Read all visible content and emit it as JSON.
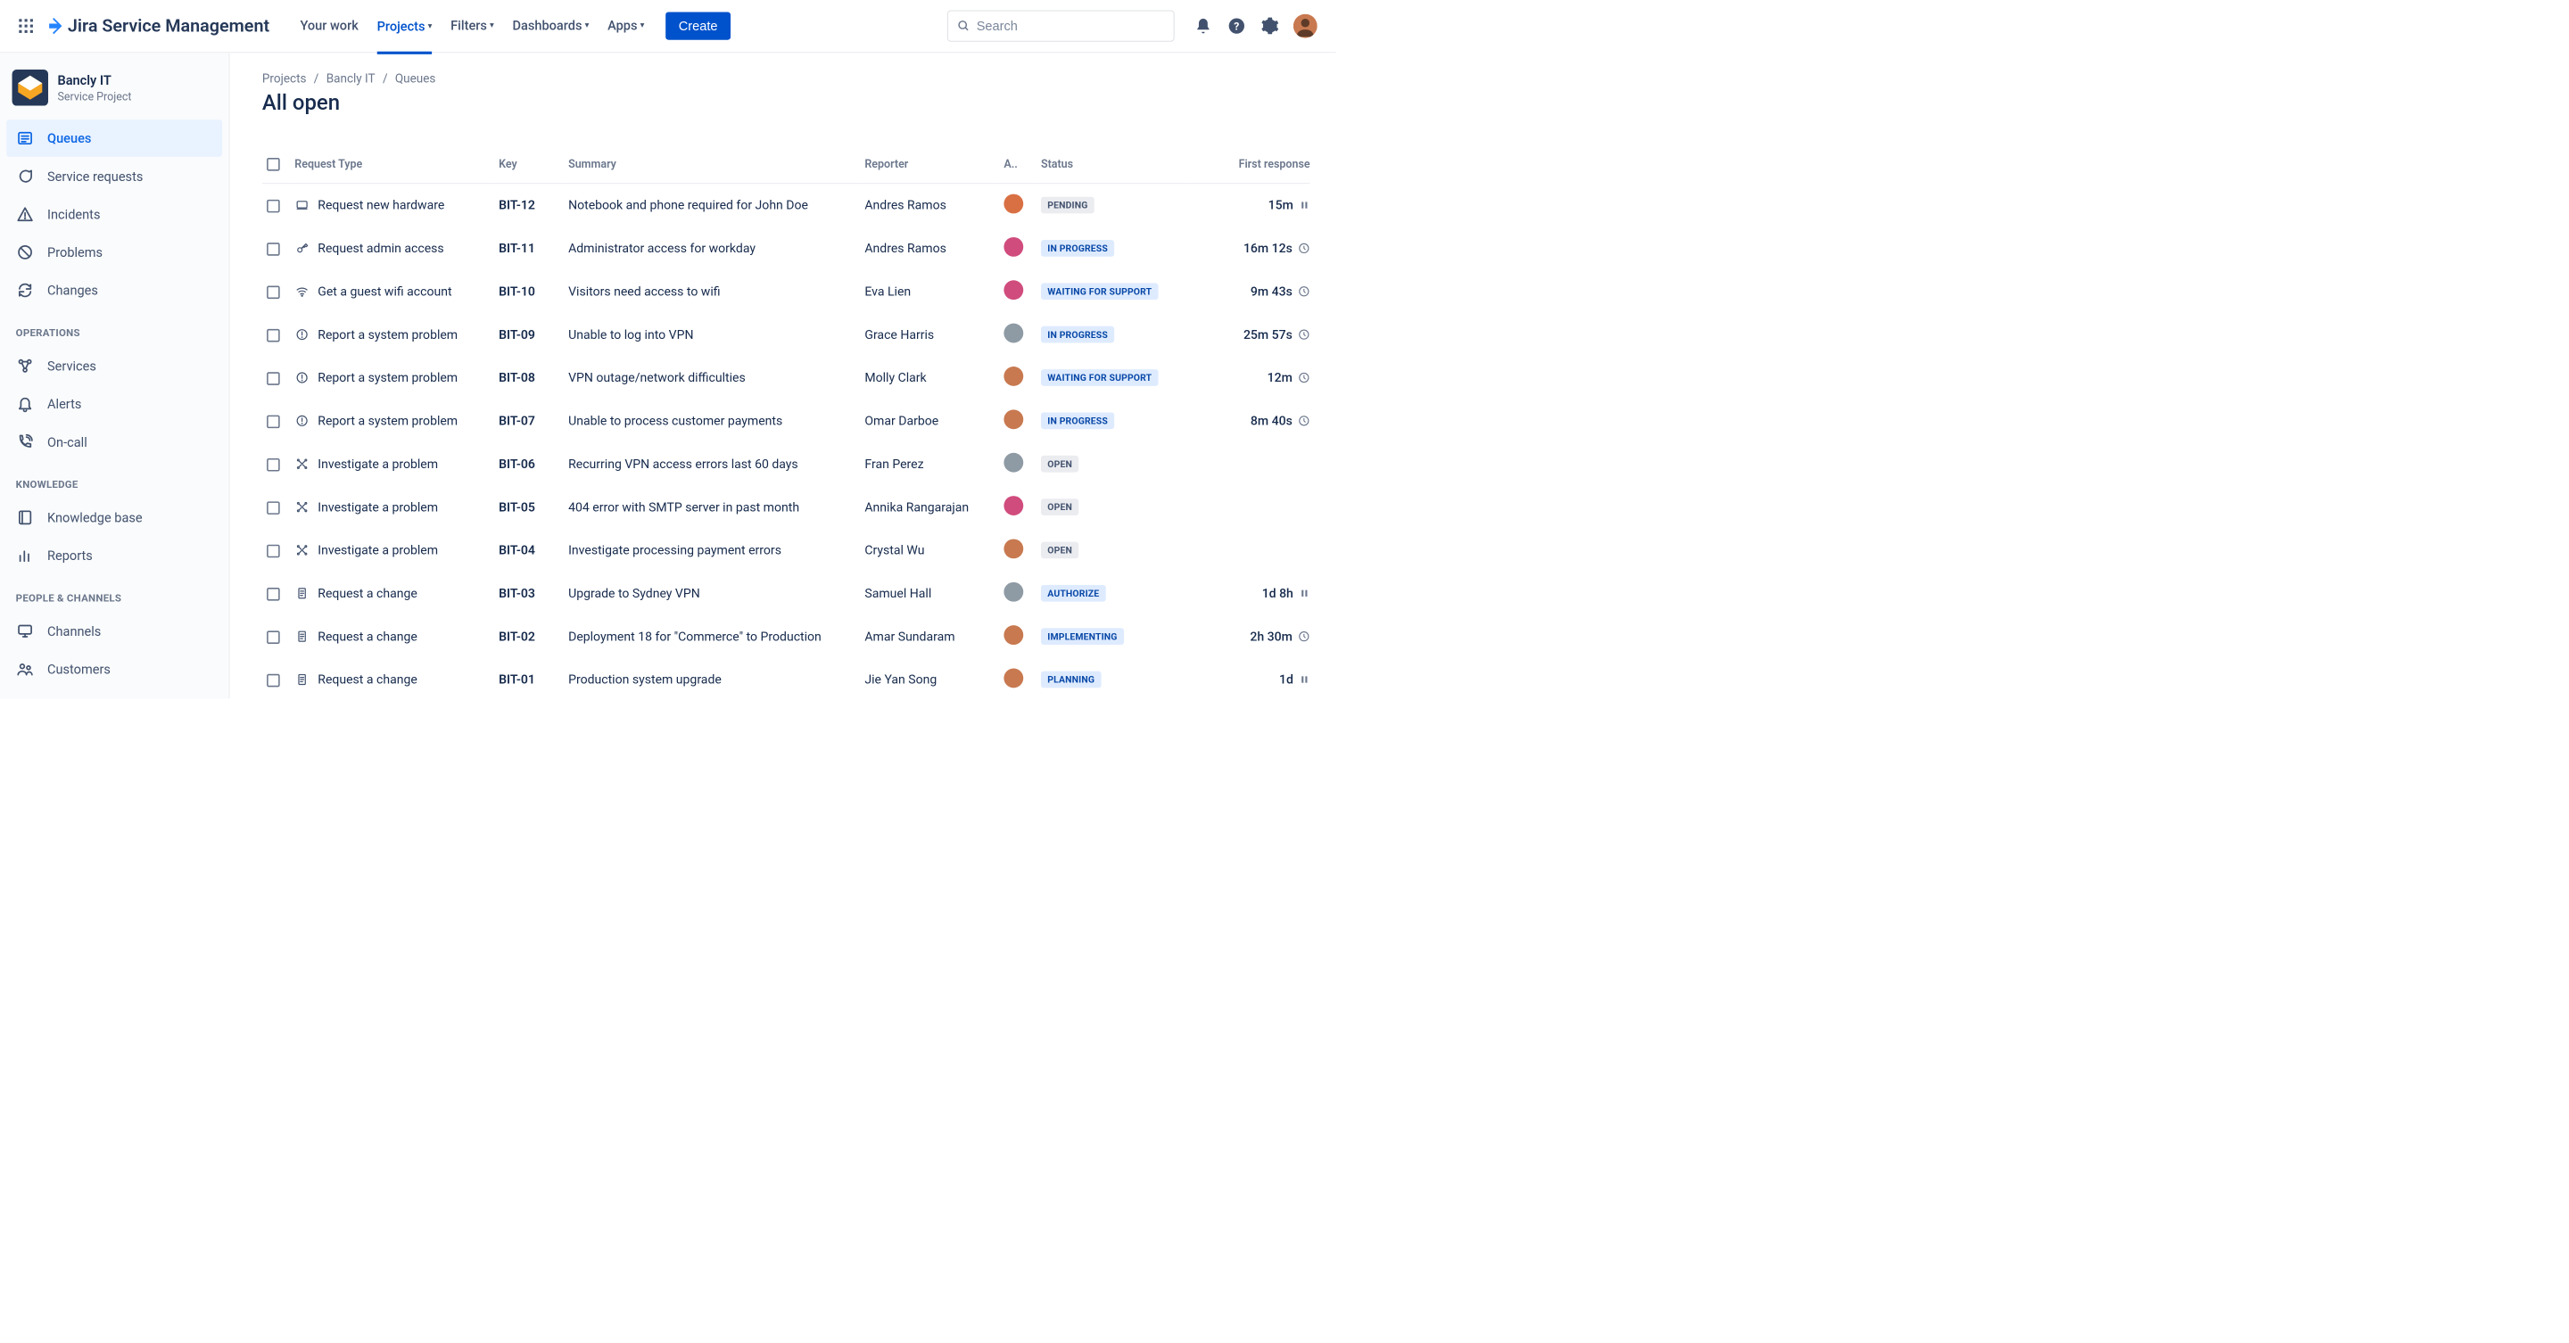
{
  "topnav": {
    "product_name": "Jira Service Management",
    "items": [
      {
        "label": "Your work",
        "has_chevron": false,
        "active": false
      },
      {
        "label": "Projects",
        "has_chevron": true,
        "active": true
      },
      {
        "label": "Filters",
        "has_chevron": true,
        "active": false
      },
      {
        "label": "Dashboards",
        "has_chevron": true,
        "active": false
      },
      {
        "label": "Apps",
        "has_chevron": true,
        "active": false
      }
    ],
    "create_label": "Create",
    "search_placeholder": "Search"
  },
  "sidebar": {
    "project": {
      "name": "Bancly IT",
      "subtitle": "Service Project"
    },
    "primary": [
      {
        "icon": "queues",
        "label": "Queues",
        "selected": true
      },
      {
        "icon": "chat",
        "label": "Service requests",
        "selected": false
      },
      {
        "icon": "incident",
        "label": "Incidents",
        "selected": false
      },
      {
        "icon": "problem",
        "label": "Problems",
        "selected": false
      },
      {
        "icon": "change",
        "label": "Changes",
        "selected": false
      }
    ],
    "operations_label": "OPERATIONS",
    "operations": [
      {
        "icon": "services",
        "label": "Services"
      },
      {
        "icon": "bell",
        "label": "Alerts"
      },
      {
        "icon": "oncall",
        "label": "On-call"
      }
    ],
    "knowledge_label": "KNOWLEDGE",
    "knowledge": [
      {
        "icon": "book",
        "label": "Knowledge base"
      },
      {
        "icon": "report",
        "label": "Reports"
      }
    ],
    "people_label": "PEOPLE & CHANNELS",
    "people": [
      {
        "icon": "monitor",
        "label": "Channels"
      },
      {
        "icon": "customers",
        "label": "Customers"
      }
    ]
  },
  "breadcrumbs": [
    "Projects",
    "Bancly IT",
    "Queues"
  ],
  "page_title": "All open",
  "columns": {
    "request_type": "Request Type",
    "key": "Key",
    "summary": "Summary",
    "reporter": "Reporter",
    "assignee": "A..",
    "status": "Status",
    "first_response": "First response"
  },
  "rows": [
    {
      "rt_icon": "hardware",
      "request_type": "Request new hardware",
      "key": "BIT-12",
      "summary": "Notebook and phone required for John Doe",
      "reporter": "Andres Ramos",
      "avatar": "#D97043",
      "status": "PENDING",
      "status_class": "pending",
      "resp": "15m",
      "resp_icon": "pause"
    },
    {
      "rt_icon": "admin",
      "request_type": "Request admin access",
      "key": "BIT-11",
      "summary": "Administrator access for workday",
      "reporter": "Andres Ramos",
      "avatar": "#D04C7D",
      "status": "IN PROGRESS",
      "status_class": "inprogress",
      "resp": "16m 12s",
      "resp_icon": "clock"
    },
    {
      "rt_icon": "wifi",
      "request_type": "Get a guest wifi account",
      "key": "BIT-10",
      "summary": "Visitors need access to wifi",
      "reporter": "Eva Lien",
      "avatar": "#D04C7D",
      "status": "WAITING FOR SUPPORT",
      "status_class": "waiting",
      "resp": "9m 43s",
      "resp_icon": "clock"
    },
    {
      "rt_icon": "alert",
      "request_type": "Report a system problem",
      "key": "BIT-09",
      "summary": "Unable to log into VPN",
      "reporter": "Grace Harris",
      "avatar": "#8E9AA4",
      "status": "IN PROGRESS",
      "status_class": "inprogress",
      "resp": "25m 57s",
      "resp_icon": "clock"
    },
    {
      "rt_icon": "alert",
      "request_type": "Report a system problem",
      "key": "BIT-08",
      "summary": "VPN outage/network difficulties",
      "reporter": "Molly Clark",
      "avatar": "#C87950",
      "status": "WAITING FOR SUPPORT",
      "status_class": "waiting",
      "resp": "12m",
      "resp_icon": "clock"
    },
    {
      "rt_icon": "alert",
      "request_type": "Report a system problem",
      "key": "BIT-07",
      "summary": "Unable to process customer payments",
      "reporter": "Omar Darboe",
      "avatar": "#C87950",
      "status": "IN PROGRESS",
      "status_class": "inprogress",
      "resp": "8m 40s",
      "resp_icon": "clock"
    },
    {
      "rt_icon": "tools",
      "request_type": "Investigate a problem",
      "key": "BIT-06",
      "summary": "Recurring VPN access errors last 60 days",
      "reporter": "Fran Perez",
      "avatar": "#8E9AA4",
      "status": "OPEN",
      "status_class": "open",
      "resp": "",
      "resp_icon": ""
    },
    {
      "rt_icon": "tools",
      "request_type": "Investigate a problem",
      "key": "BIT-05",
      "summary": "404 error with SMTP server in past month",
      "reporter": "Annika Rangarajan",
      "avatar": "#D04C7D",
      "status": "OPEN",
      "status_class": "open",
      "resp": "",
      "resp_icon": ""
    },
    {
      "rt_icon": "tools",
      "request_type": "Investigate a problem",
      "key": "BIT-04",
      "summary": "Investigate processing payment errors",
      "reporter": "Crystal Wu",
      "avatar": "#C87950",
      "status": "OPEN",
      "status_class": "open",
      "resp": "",
      "resp_icon": ""
    },
    {
      "rt_icon": "doc",
      "request_type": "Request a change",
      "key": "BIT-03",
      "summary": "Upgrade to Sydney VPN",
      "reporter": "Samuel Hall",
      "avatar": "#8E9AA4",
      "status": "AUTHORIZE",
      "status_class": "authorize",
      "resp": "1d 8h",
      "resp_icon": "pause"
    },
    {
      "rt_icon": "doc",
      "request_type": "Request a change",
      "key": "BIT-02",
      "summary": "Deployment 18 for \"Commerce\" to Production",
      "reporter": "Amar Sundaram",
      "avatar": "#C87950",
      "status": "IMPLEMENTING",
      "status_class": "implementing",
      "resp": "2h 30m",
      "resp_icon": "clock"
    },
    {
      "rt_icon": "doc",
      "request_type": "Request a change",
      "key": "BIT-01",
      "summary": "Production system upgrade",
      "reporter": "Jie Yan Song",
      "avatar": "#C87950",
      "status": "PLANNING",
      "status_class": "planning",
      "resp": "1d",
      "resp_icon": "pause"
    }
  ]
}
